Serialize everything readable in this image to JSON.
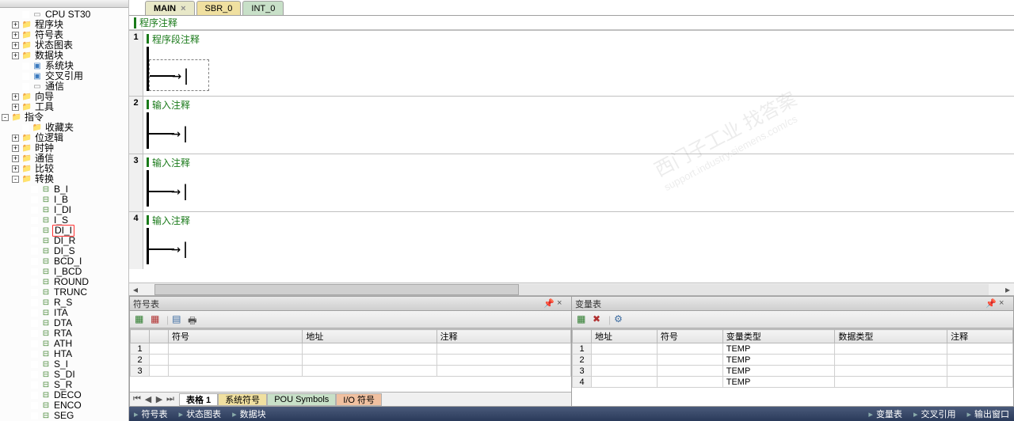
{
  "sidebar": {
    "items": [
      {
        "indent": 28,
        "hit": "",
        "icon": "page",
        "label": "CPU ST30"
      },
      {
        "indent": 15,
        "hit": "+",
        "icon": "folder",
        "label": "程序块"
      },
      {
        "indent": 15,
        "hit": "+",
        "icon": "folder",
        "label": "符号表"
      },
      {
        "indent": 15,
        "hit": "+",
        "icon": "folder",
        "label": "状态图表"
      },
      {
        "indent": 15,
        "hit": "+",
        "icon": "folder",
        "label": "数据块"
      },
      {
        "indent": 28,
        "hit": "",
        "icon": "block",
        "label": "系统块"
      },
      {
        "indent": 28,
        "hit": "",
        "icon": "block",
        "label": "交叉引用"
      },
      {
        "indent": 28,
        "hit": "",
        "icon": "page",
        "label": "通信"
      },
      {
        "indent": 15,
        "hit": "+",
        "icon": "folder",
        "label": "向导"
      },
      {
        "indent": 15,
        "hit": "+",
        "icon": "folder",
        "label": "工具"
      },
      {
        "indent": 2,
        "hit": "-",
        "icon": "folder",
        "label": "指令"
      },
      {
        "indent": 28,
        "hit": "",
        "icon": "folder",
        "label": "收藏夹"
      },
      {
        "indent": 15,
        "hit": "+",
        "icon": "folder",
        "label": "位逻辑"
      },
      {
        "indent": 15,
        "hit": "+",
        "icon": "folder",
        "label": "时钟"
      },
      {
        "indent": 15,
        "hit": "+",
        "icon": "folder",
        "label": "通信"
      },
      {
        "indent": 15,
        "hit": "+",
        "icon": "folder",
        "label": "比较"
      },
      {
        "indent": 15,
        "hit": "-",
        "icon": "folder",
        "label": "转换"
      },
      {
        "indent": 39,
        "hit": "",
        "icon": "inst",
        "label": "B_I"
      },
      {
        "indent": 39,
        "hit": "",
        "icon": "inst",
        "label": "I_B"
      },
      {
        "indent": 39,
        "hit": "",
        "icon": "inst",
        "label": "I_DI"
      },
      {
        "indent": 39,
        "hit": "",
        "icon": "inst",
        "label": "I_S"
      },
      {
        "indent": 39,
        "hit": "",
        "icon": "inst",
        "label": "DI_I",
        "hl": true
      },
      {
        "indent": 39,
        "hit": "",
        "icon": "inst",
        "label": "DI_R"
      },
      {
        "indent": 39,
        "hit": "",
        "icon": "inst",
        "label": "DI_S"
      },
      {
        "indent": 39,
        "hit": "",
        "icon": "inst",
        "label": "BCD_I"
      },
      {
        "indent": 39,
        "hit": "",
        "icon": "inst",
        "label": "I_BCD"
      },
      {
        "indent": 39,
        "hit": "",
        "icon": "inst",
        "label": "ROUND"
      },
      {
        "indent": 39,
        "hit": "",
        "icon": "inst",
        "label": "TRUNC"
      },
      {
        "indent": 39,
        "hit": "",
        "icon": "inst",
        "label": "R_S"
      },
      {
        "indent": 39,
        "hit": "",
        "icon": "inst",
        "label": "ITA"
      },
      {
        "indent": 39,
        "hit": "",
        "icon": "inst",
        "label": "DTA"
      },
      {
        "indent": 39,
        "hit": "",
        "icon": "inst",
        "label": "RTA"
      },
      {
        "indent": 39,
        "hit": "",
        "icon": "inst",
        "label": "ATH"
      },
      {
        "indent": 39,
        "hit": "",
        "icon": "inst",
        "label": "HTA"
      },
      {
        "indent": 39,
        "hit": "",
        "icon": "inst",
        "label": "S_I"
      },
      {
        "indent": 39,
        "hit": "",
        "icon": "inst",
        "label": "S_DI"
      },
      {
        "indent": 39,
        "hit": "",
        "icon": "inst",
        "label": "S_R"
      },
      {
        "indent": 39,
        "hit": "",
        "icon": "inst",
        "label": "DECO"
      },
      {
        "indent": 39,
        "hit": "",
        "icon": "inst",
        "label": "ENCO"
      },
      {
        "indent": 39,
        "hit": "",
        "icon": "inst",
        "label": "SEG"
      }
    ]
  },
  "tabs": [
    {
      "label": "MAIN",
      "kind": "active",
      "close": true
    },
    {
      "label": "SBR_0",
      "kind": "sbr"
    },
    {
      "label": "INT_0",
      "kind": "int"
    }
  ],
  "program_comment": "程序注释",
  "networks": [
    {
      "num": "1",
      "comment": "程序段注释",
      "dashed": true
    },
    {
      "num": "2",
      "comment": "输入注释",
      "dashed": false
    },
    {
      "num": "3",
      "comment": "输入注释",
      "dashed": false
    },
    {
      "num": "4",
      "comment": "输入注释",
      "dashed": false
    }
  ],
  "watermark": {
    "big": "西门子工业   找答案",
    "small": "support.industry.siemens.com/cs"
  },
  "symtable": {
    "title": "符号表",
    "cols": [
      "",
      "",
      "符号",
      "地址",
      "注释"
    ],
    "rows": [
      {
        "n": "1"
      },
      {
        "n": "2"
      },
      {
        "n": "3"
      }
    ],
    "tabs": [
      {
        "label": "表格 1",
        "cls": "active"
      },
      {
        "label": "系统符号",
        "cls": "t2"
      },
      {
        "label": "POU Symbols",
        "cls": "t3"
      },
      {
        "label": "I/O 符号",
        "cls": "t4"
      }
    ]
  },
  "vartable": {
    "title": "变量表",
    "cols": [
      "",
      "地址",
      "符号",
      "变量类型",
      "数据类型",
      "注释"
    ],
    "rows": [
      {
        "n": "1",
        "t": "TEMP"
      },
      {
        "n": "2",
        "t": "TEMP"
      },
      {
        "n": "3",
        "t": "TEMP"
      },
      {
        "n": "4",
        "t": "TEMP"
      }
    ]
  },
  "status": [
    "符号表",
    "状态图表",
    "数据块"
  ],
  "status2": [
    "变量表",
    "交叉引用",
    "输出窗口"
  ]
}
